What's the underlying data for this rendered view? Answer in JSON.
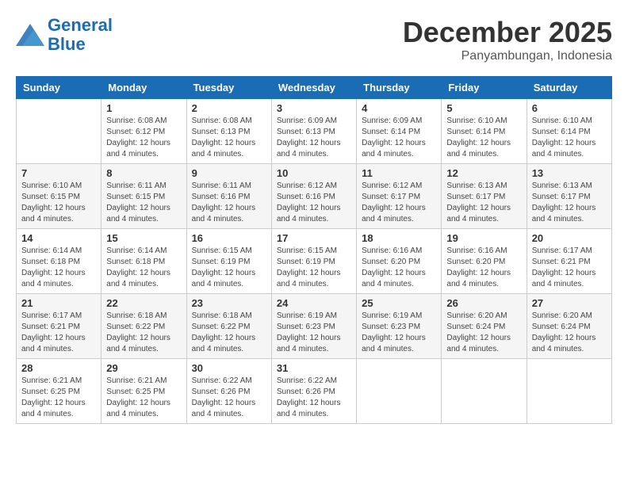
{
  "header": {
    "logo_line1": "General",
    "logo_line2": "Blue",
    "month": "December 2025",
    "location": "Panyambungan, Indonesia"
  },
  "days_of_week": [
    "Sunday",
    "Monday",
    "Tuesday",
    "Wednesday",
    "Thursday",
    "Friday",
    "Saturday"
  ],
  "weeks": [
    [
      {
        "day": "",
        "sunrise": "",
        "sunset": "",
        "daylight": ""
      },
      {
        "day": "1",
        "sunrise": "Sunrise: 6:08 AM",
        "sunset": "Sunset: 6:12 PM",
        "daylight": "Daylight: 12 hours and 4 minutes."
      },
      {
        "day": "2",
        "sunrise": "Sunrise: 6:08 AM",
        "sunset": "Sunset: 6:13 PM",
        "daylight": "Daylight: 12 hours and 4 minutes."
      },
      {
        "day": "3",
        "sunrise": "Sunrise: 6:09 AM",
        "sunset": "Sunset: 6:13 PM",
        "daylight": "Daylight: 12 hours and 4 minutes."
      },
      {
        "day": "4",
        "sunrise": "Sunrise: 6:09 AM",
        "sunset": "Sunset: 6:14 PM",
        "daylight": "Daylight: 12 hours and 4 minutes."
      },
      {
        "day": "5",
        "sunrise": "Sunrise: 6:10 AM",
        "sunset": "Sunset: 6:14 PM",
        "daylight": "Daylight: 12 hours and 4 minutes."
      },
      {
        "day": "6",
        "sunrise": "Sunrise: 6:10 AM",
        "sunset": "Sunset: 6:14 PM",
        "daylight": "Daylight: 12 hours and 4 minutes."
      }
    ],
    [
      {
        "day": "7",
        "sunrise": "Sunrise: 6:10 AM",
        "sunset": "Sunset: 6:15 PM",
        "daylight": "Daylight: 12 hours and 4 minutes."
      },
      {
        "day": "8",
        "sunrise": "Sunrise: 6:11 AM",
        "sunset": "Sunset: 6:15 PM",
        "daylight": "Daylight: 12 hours and 4 minutes."
      },
      {
        "day": "9",
        "sunrise": "Sunrise: 6:11 AM",
        "sunset": "Sunset: 6:16 PM",
        "daylight": "Daylight: 12 hours and 4 minutes."
      },
      {
        "day": "10",
        "sunrise": "Sunrise: 6:12 AM",
        "sunset": "Sunset: 6:16 PM",
        "daylight": "Daylight: 12 hours and 4 minutes."
      },
      {
        "day": "11",
        "sunrise": "Sunrise: 6:12 AM",
        "sunset": "Sunset: 6:17 PM",
        "daylight": "Daylight: 12 hours and 4 minutes."
      },
      {
        "day": "12",
        "sunrise": "Sunrise: 6:13 AM",
        "sunset": "Sunset: 6:17 PM",
        "daylight": "Daylight: 12 hours and 4 minutes."
      },
      {
        "day": "13",
        "sunrise": "Sunrise: 6:13 AM",
        "sunset": "Sunset: 6:17 PM",
        "daylight": "Daylight: 12 hours and 4 minutes."
      }
    ],
    [
      {
        "day": "14",
        "sunrise": "Sunrise: 6:14 AM",
        "sunset": "Sunset: 6:18 PM",
        "daylight": "Daylight: 12 hours and 4 minutes."
      },
      {
        "day": "15",
        "sunrise": "Sunrise: 6:14 AM",
        "sunset": "Sunset: 6:18 PM",
        "daylight": "Daylight: 12 hours and 4 minutes."
      },
      {
        "day": "16",
        "sunrise": "Sunrise: 6:15 AM",
        "sunset": "Sunset: 6:19 PM",
        "daylight": "Daylight: 12 hours and 4 minutes."
      },
      {
        "day": "17",
        "sunrise": "Sunrise: 6:15 AM",
        "sunset": "Sunset: 6:19 PM",
        "daylight": "Daylight: 12 hours and 4 minutes."
      },
      {
        "day": "18",
        "sunrise": "Sunrise: 6:16 AM",
        "sunset": "Sunset: 6:20 PM",
        "daylight": "Daylight: 12 hours and 4 minutes."
      },
      {
        "day": "19",
        "sunrise": "Sunrise: 6:16 AM",
        "sunset": "Sunset: 6:20 PM",
        "daylight": "Daylight: 12 hours and 4 minutes."
      },
      {
        "day": "20",
        "sunrise": "Sunrise: 6:17 AM",
        "sunset": "Sunset: 6:21 PM",
        "daylight": "Daylight: 12 hours and 4 minutes."
      }
    ],
    [
      {
        "day": "21",
        "sunrise": "Sunrise: 6:17 AM",
        "sunset": "Sunset: 6:21 PM",
        "daylight": "Daylight: 12 hours and 4 minutes."
      },
      {
        "day": "22",
        "sunrise": "Sunrise: 6:18 AM",
        "sunset": "Sunset: 6:22 PM",
        "daylight": "Daylight: 12 hours and 4 minutes."
      },
      {
        "day": "23",
        "sunrise": "Sunrise: 6:18 AM",
        "sunset": "Sunset: 6:22 PM",
        "daylight": "Daylight: 12 hours and 4 minutes."
      },
      {
        "day": "24",
        "sunrise": "Sunrise: 6:19 AM",
        "sunset": "Sunset: 6:23 PM",
        "daylight": "Daylight: 12 hours and 4 minutes."
      },
      {
        "day": "25",
        "sunrise": "Sunrise: 6:19 AM",
        "sunset": "Sunset: 6:23 PM",
        "daylight": "Daylight: 12 hours and 4 minutes."
      },
      {
        "day": "26",
        "sunrise": "Sunrise: 6:20 AM",
        "sunset": "Sunset: 6:24 PM",
        "daylight": "Daylight: 12 hours and 4 minutes."
      },
      {
        "day": "27",
        "sunrise": "Sunrise: 6:20 AM",
        "sunset": "Sunset: 6:24 PM",
        "daylight": "Daylight: 12 hours and 4 minutes."
      }
    ],
    [
      {
        "day": "28",
        "sunrise": "Sunrise: 6:21 AM",
        "sunset": "Sunset: 6:25 PM",
        "daylight": "Daylight: 12 hours and 4 minutes."
      },
      {
        "day": "29",
        "sunrise": "Sunrise: 6:21 AM",
        "sunset": "Sunset: 6:25 PM",
        "daylight": "Daylight: 12 hours and 4 minutes."
      },
      {
        "day": "30",
        "sunrise": "Sunrise: 6:22 AM",
        "sunset": "Sunset: 6:26 PM",
        "daylight": "Daylight: 12 hours and 4 minutes."
      },
      {
        "day": "31",
        "sunrise": "Sunrise: 6:22 AM",
        "sunset": "Sunset: 6:26 PM",
        "daylight": "Daylight: 12 hours and 4 minutes."
      },
      {
        "day": "",
        "sunrise": "",
        "sunset": "",
        "daylight": ""
      },
      {
        "day": "",
        "sunrise": "",
        "sunset": "",
        "daylight": ""
      },
      {
        "day": "",
        "sunrise": "",
        "sunset": "",
        "daylight": ""
      }
    ]
  ]
}
